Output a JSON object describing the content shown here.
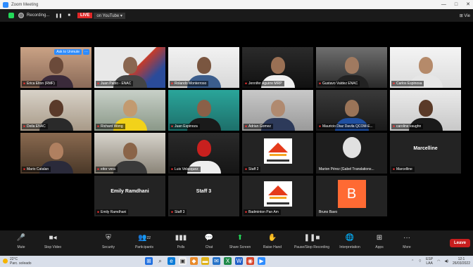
{
  "window": {
    "title": "Zoom Meeting",
    "controls": [
      "—",
      "□",
      "✕"
    ]
  },
  "topbar": {
    "recording_label": "Recording...",
    "pause_symbol": "❚❚",
    "stop_symbol": "■",
    "live_label": "LIVE",
    "youtube_label": "on YouTube ▾",
    "view_label": "⊞ Vie"
  },
  "participants": [
    {
      "name": "Erica Elton (RMF)",
      "ask_label": "Ask to Unmute",
      "more_label": "···"
    },
    {
      "name": "Juan Pablo - ENAC",
      "active": true
    },
    {
      "name": "Rolando Monterroso"
    },
    {
      "name": "Jennifer Aguirre MRP"
    },
    {
      "name": "Gustavo Valdez ENAC"
    },
    {
      "name": "Carlos Espinosa"
    },
    {
      "name": "Deila ENAC"
    },
    {
      "name": "Richard Wong"
    },
    {
      "name": "Juan Espinoza"
    },
    {
      "name": "Adrian Gomez"
    },
    {
      "name": "Mauricio Diaz Davila QCOM-E..."
    },
    {
      "name": "caroline vaughn"
    },
    {
      "name": "Mario Catalan"
    },
    {
      "name": "eitor vera"
    },
    {
      "name": "Luis Velasquez"
    },
    {
      "name": "Staff 2"
    },
    {
      "name": "Marion Pérez (Gabel Translations..."
    },
    {
      "name": "Marcelline",
      "display": "Marcelline"
    },
    {
      "name": "Emily Ramdhani",
      "display": "Emily Ramdhani"
    },
    {
      "name": "Staff 3",
      "display": "Staff 3"
    },
    {
      "name": "Badminton Pan Am"
    },
    {
      "name": "Bruno Bavo",
      "initial": "B"
    }
  ],
  "toolbar": {
    "items": [
      {
        "icon": "🎤",
        "label": "Mute"
      },
      {
        "icon": "■◂",
        "label": "Stop Video"
      },
      {
        "icon": "⛨",
        "label": "Security"
      },
      {
        "icon": "👥",
        "label": "Participants",
        "count": "22"
      },
      {
        "icon": "▮▮▮",
        "label": "Polls"
      },
      {
        "icon": "💬",
        "label": "Chat"
      },
      {
        "icon": "⬆",
        "label": "Share Screen"
      },
      {
        "icon": "✋",
        "label": "Raise Hand"
      },
      {
        "icon": "❚❚■",
        "label": "Pause/Stop Recording"
      },
      {
        "icon": "🌐",
        "label": "Interpretation"
      },
      {
        "icon": "⊞",
        "label": "Apps"
      },
      {
        "icon": "···",
        "label": "More"
      }
    ],
    "leave_label": "Leave"
  },
  "taskbar": {
    "weather_temp": "22°C",
    "weather_desc": "Parc. soleado",
    "lang_top": "ESP",
    "lang_bottom": "LAA",
    "time": "12:1",
    "date": "26/03/2022"
  },
  "colors": {
    "accent": "#2d8cff",
    "live": "#e02828",
    "leave": "#c91e1e",
    "active_outline": "#b6e33b"
  }
}
